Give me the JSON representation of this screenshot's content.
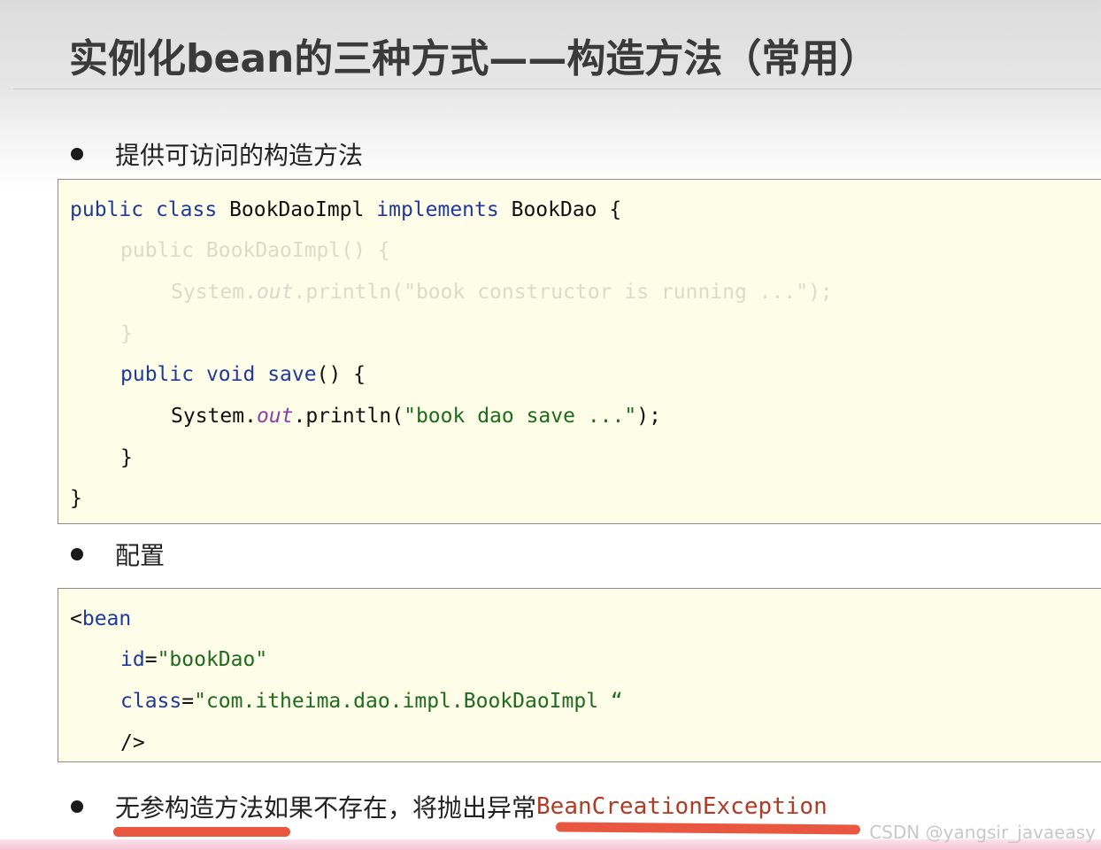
{
  "slide": {
    "title": "实例化bean的三种方式——构造方法（常用）"
  },
  "bullets": {
    "b1": "提供可访问的构造方法",
    "b2": "配置",
    "b3_text": "无参构造方法如果不存在，将抛出异常",
    "b3_exception": "BeanCreationException"
  },
  "java_code": {
    "l1_public": "public",
    "l1_class": "class",
    "l1_name": "BookDaoImpl",
    "l1_implements": "implements",
    "l1_iface": "BookDao {",
    "l2": "public BookDaoImpl() {",
    "l3_system": "System.",
    "l3_out": "out",
    "l3_rest": ".println(\"book constructor is running ...\");",
    "l4": "}",
    "l5_public": "public",
    "l5_void": "void",
    "l5_save": "save",
    "l5_rest": "() {",
    "l6_system": "System.",
    "l6_out": "out",
    "l6_println": ".println(",
    "l6_str": "\"book dao save ...\"",
    "l6_end": ");",
    "l7": "}",
    "l8": "}"
  },
  "xml_code": {
    "l1_open": "<",
    "l1_tag": "bean",
    "l2_attr": "id",
    "l2_eq": "=",
    "l2_val": "\"bookDao\"",
    "l3_attr": "class",
    "l3_eq": "=",
    "l3_val": "\"com.itheima.dao.impl.BookDaoImpl “",
    "l4": "/>"
  },
  "watermark": "CSDN @yangsir_javaeasy",
  "colors": {
    "keyword": "#1f3a99",
    "string": "#1d6b1d",
    "field": "#8b3ea8",
    "exception": "#b03a22",
    "code_bg": "#fefde8",
    "scribble": "#e8452c"
  }
}
